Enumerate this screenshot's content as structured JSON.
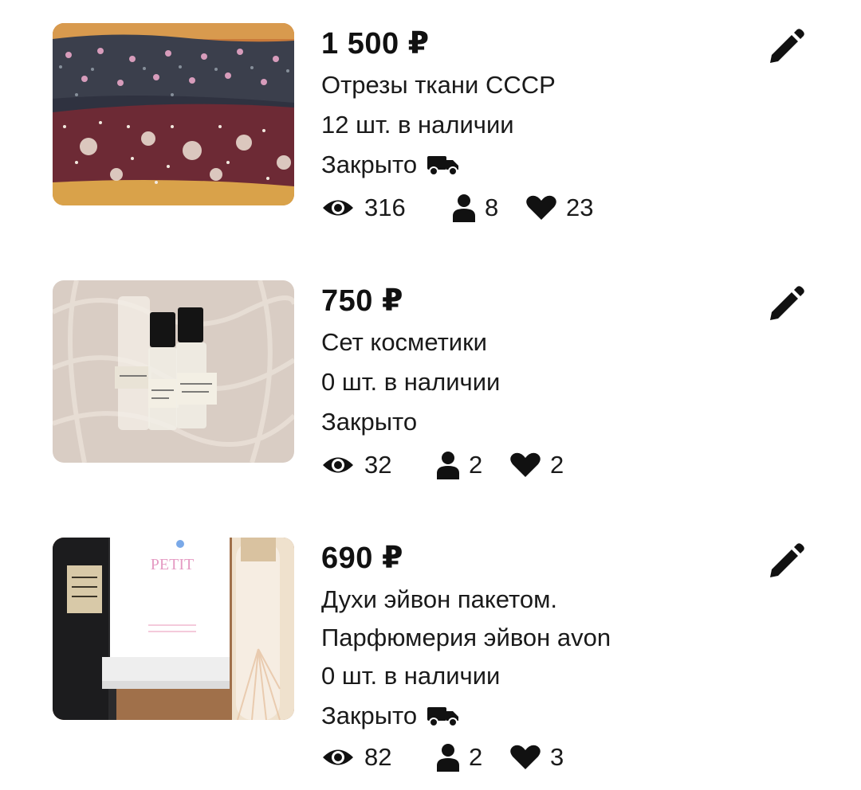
{
  "listings": [
    {
      "price": "1 500 ₽",
      "title_lines": [
        "Отрезы ткани СССР"
      ],
      "stock": "12 шт. в наличии",
      "status": "Закрыто",
      "has_delivery_icon": true,
      "views": "316",
      "contacts": "8",
      "favorites": "23",
      "image_icon": "fabric-photo"
    },
    {
      "price": "750 ₽",
      "title_lines": [
        "Сет косметики"
      ],
      "stock": "0 шт. в наличии",
      "status": "Закрыто",
      "has_delivery_icon": false,
      "views": "32",
      "contacts": "2",
      "favorites": "2",
      "image_icon": "perfume-samples-photo"
    },
    {
      "price": "690 ₽",
      "title_lines": [
        "Духи эйвон пакетом.",
        "Парфюмерия эйвон avon"
      ],
      "stock": "0 шт. в наличии",
      "status": "Закрыто",
      "has_delivery_icon": true,
      "views": "82",
      "contacts": "2",
      "favorites": "3",
      "image_icon": "avon-perfume-photo"
    }
  ],
  "icons": {
    "edit": "pencil-icon",
    "views": "eye-icon",
    "contacts": "person-icon",
    "favorites": "heart-icon",
    "delivery": "truck-icon"
  },
  "colors": {
    "text": "#111111",
    "icon": "#111111",
    "background": "#ffffff"
  }
}
